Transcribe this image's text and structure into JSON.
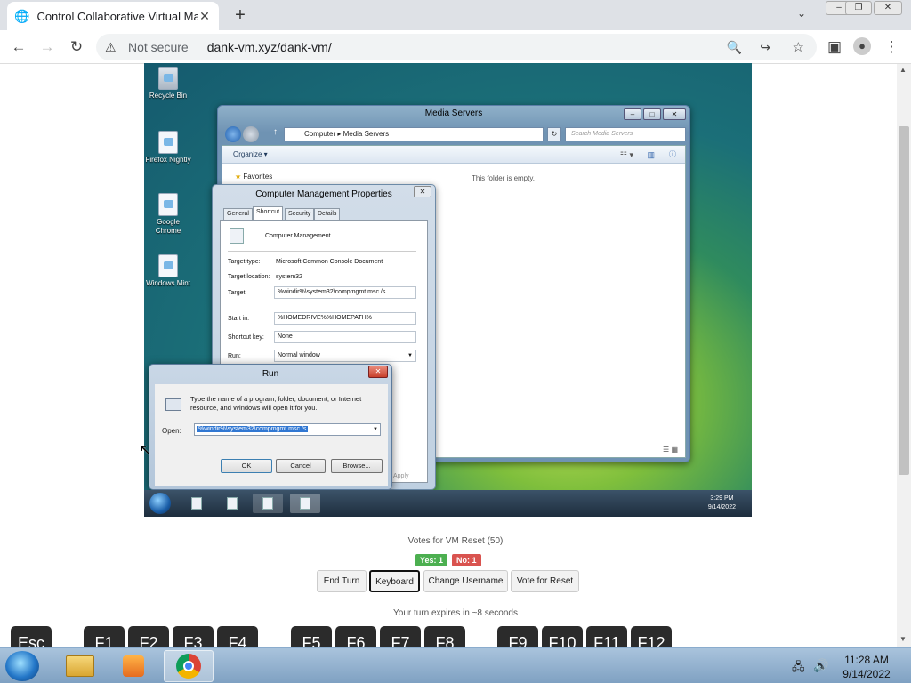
{
  "browser": {
    "tab_title": "Control Collaborative Virtual Ma",
    "tab_close": "✕",
    "new_tab": "+",
    "window_controls": [
      "–",
      "❐",
      "✕"
    ],
    "security_label": "Not secure",
    "url": "dank-vm.xyz/dank-vm/"
  },
  "vm": {
    "desktop_icons": [
      "Recycle Bin",
      "Firefox Nightly",
      "Google Chrome",
      "Windows Mint"
    ],
    "explorer": {
      "title": "Media Servers",
      "breadcrumb": "Computer ▸ Media Servers",
      "search_placeholder": "Search Media Servers",
      "organize_label": "Organize ▾",
      "favorites_label": "Favorites",
      "empty_message": "This folder is empty."
    },
    "properties": {
      "title": "Computer Management Properties",
      "tabs": [
        "General",
        "Shortcut",
        "Security",
        "Details"
      ],
      "name": "Computer Management",
      "target_type_label": "Target type:",
      "target_type": "Microsoft Common Console Document",
      "target_location_label": "Target location:",
      "target_location": "system32",
      "target_label": "Target:",
      "target": "%windir%\\system32\\compmgmt.msc /s",
      "start_in_label": "Start in:",
      "start_in": "%HOMEDRIVE%%HOMEPATH%",
      "shortcut_key_label": "Shortcut key:",
      "shortcut_key": "None",
      "run_label": "Run:",
      "run_value": "Normal window",
      "apply_label": "Apply"
    },
    "run_dialog": {
      "title": "Run",
      "description": "Type the name of a program, folder, document, or Internet resource, and Windows will open it for you.",
      "open_label": "Open:",
      "open_value": "%windir%\\system32\\compmgmt.msc /s",
      "ok_label": "OK",
      "cancel_label": "Cancel",
      "browse_label": "Browse..."
    },
    "clock": {
      "time": "3:29 PM",
      "date": "9/14/2022"
    }
  },
  "controls": {
    "votes_text": "Votes for VM Reset (50)",
    "yes_badge": "Yes: 1",
    "no_badge": "No: 1",
    "buttons": [
      "End Turn",
      "Keyboard",
      "Change Username",
      "Vote for Reset"
    ],
    "turn_text": "Your turn expires in ~8 seconds",
    "fkeys": [
      "Esc",
      "F1",
      "F2",
      "F3",
      "F4",
      "F5",
      "F6",
      "F7",
      "F8",
      "F9",
      "F10",
      "F11",
      "F12"
    ]
  },
  "host_clock": {
    "time": "11:28 AM",
    "date": "9/14/2022"
  },
  "colors": {
    "yes": "#4caf50",
    "no": "#d9534f"
  }
}
